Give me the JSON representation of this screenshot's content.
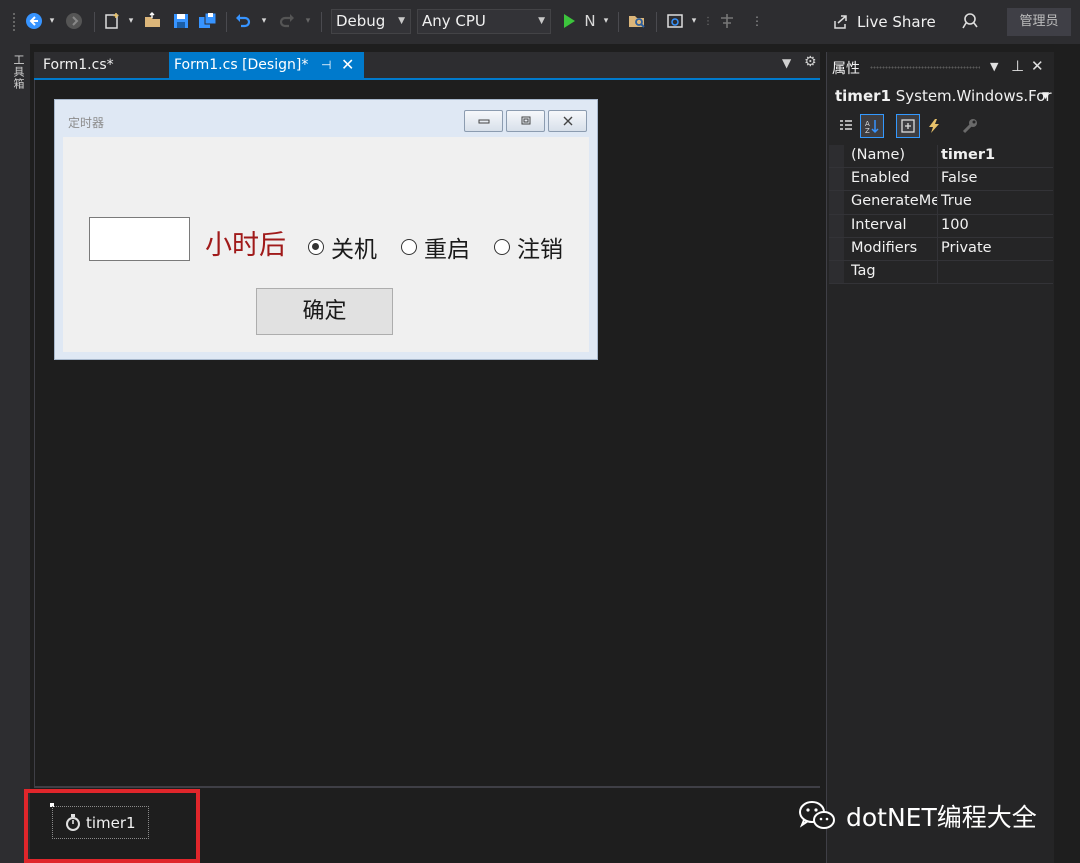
{
  "toolbar": {
    "config": "Debug",
    "platform": "Any CPU",
    "run_label": "N",
    "live_share": "Live Share",
    "admin_badge": "管理员"
  },
  "toolbox_tab": "工具箱",
  "tabs": [
    {
      "label": "Form1.cs*",
      "active": false
    },
    {
      "label": "Form1.cs [Design]*",
      "active": true
    }
  ],
  "form": {
    "title": "定时器",
    "hours_input_value": "",
    "hours_label": "小时后",
    "radios": [
      {
        "label": "关机",
        "checked": true
      },
      {
        "label": "重启",
        "checked": false
      },
      {
        "label": "注销",
        "checked": false
      }
    ],
    "ok_button": "确定"
  },
  "properties": {
    "title": "属性",
    "object_name": "timer1",
    "object_type": "System.Windows.For",
    "rows": [
      {
        "name": "(Name)",
        "value": "timer1"
      },
      {
        "name": "Enabled",
        "value": "False"
      },
      {
        "name": "GenerateMember",
        "value": "True"
      },
      {
        "name": "Interval",
        "value": "100"
      },
      {
        "name": "Modifiers",
        "value": "Private"
      },
      {
        "name": "Tag",
        "value": ""
      }
    ]
  },
  "tray": {
    "component_label": "timer1"
  },
  "watermark": "dotNET编程大全",
  "colors": {
    "accent": "#007acc",
    "highlight_box": "#e0262b",
    "hours_label": "#a01a1a"
  }
}
